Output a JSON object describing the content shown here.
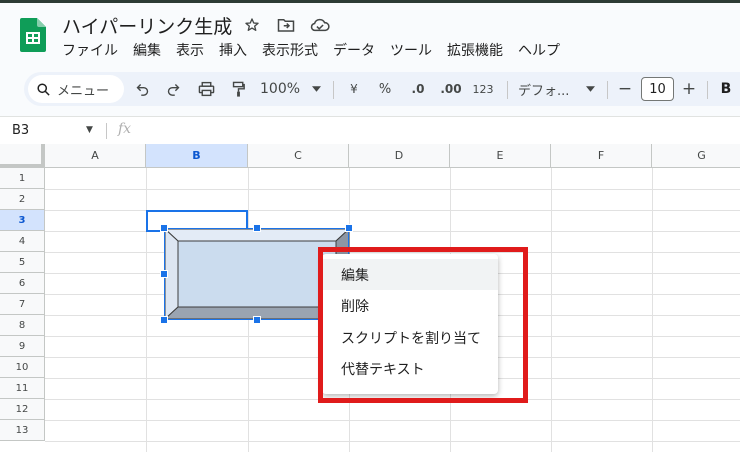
{
  "app": {
    "doc_title": "ハイパーリンク生成",
    "brand_color": "#0f9d58"
  },
  "menu": [
    "ファイル",
    "編集",
    "表示",
    "挿入",
    "表示形式",
    "データ",
    "ツール",
    "拡張機能",
    "ヘルプ"
  ],
  "toolbar": {
    "search_label": "メニュー",
    "zoom": "100%",
    "currency": "¥",
    "percent": "%",
    "dec_decrease": ".0",
    "dec_increase": ".00",
    "number_format": "123",
    "font": "デフォ...",
    "minus": "−",
    "font_size": "10",
    "plus": "+",
    "bold": "B"
  },
  "formula_bar": {
    "name_box": "B3",
    "fx": "fx"
  },
  "columns": [
    "A",
    "B",
    "C",
    "D",
    "E",
    "F",
    "G"
  ],
  "rows": [
    "1",
    "2",
    "3",
    "4",
    "5",
    "6",
    "7",
    "8",
    "9",
    "10",
    "11",
    "12",
    "13"
  ],
  "selected_cell": "B3",
  "context_menu": {
    "items": [
      "編集",
      "削除",
      "スクリプトを割り当て",
      "代替テキスト"
    ]
  },
  "highlight_color": "#e01b1b"
}
